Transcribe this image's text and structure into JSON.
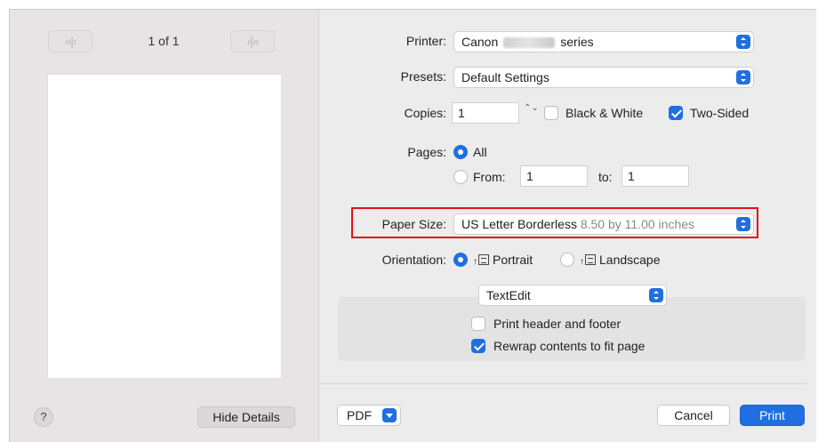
{
  "preview_panel": {
    "first_page_glyph": "«|‹",
    "next_page_glyph": "›|»",
    "page_indicator": "1 of 1",
    "help_label": "?",
    "hide_details_label": "Hide Details"
  },
  "printer": {
    "label": "Printer:",
    "name_prefix": "Canon",
    "name_suffix": "series"
  },
  "presets": {
    "label": "Presets:",
    "value": "Default Settings"
  },
  "copies": {
    "label": "Copies:",
    "value": "1",
    "stepper_glyph": "⌃⌄"
  },
  "black_white": {
    "label": "Black & White",
    "checked": false
  },
  "two_sided": {
    "label": "Two-Sided",
    "checked": true
  },
  "pages": {
    "label": "Pages:",
    "all_label": "All",
    "from_label": "From:",
    "from_value": "1",
    "to_label": "to:",
    "to_value": "1",
    "selected": "All"
  },
  "paper_size": {
    "label": "Paper Size:",
    "value": "US Letter Borderless",
    "dimensions": "8.50 by 11.00 inches"
  },
  "orientation": {
    "label": "Orientation:",
    "portrait_label": "Portrait",
    "landscape_label": "Landscape",
    "selected": "Portrait"
  },
  "app_section": {
    "value": "TextEdit",
    "header_footer_label": "Print header and footer",
    "header_footer_checked": false,
    "rewrap_label": "Rewrap contents to fit page",
    "rewrap_checked": true
  },
  "footer": {
    "pdf_label": "PDF",
    "cancel_label": "Cancel",
    "print_label": "Print"
  },
  "colors": {
    "accent": "#1f6fe0",
    "highlight": "#e0101e"
  }
}
